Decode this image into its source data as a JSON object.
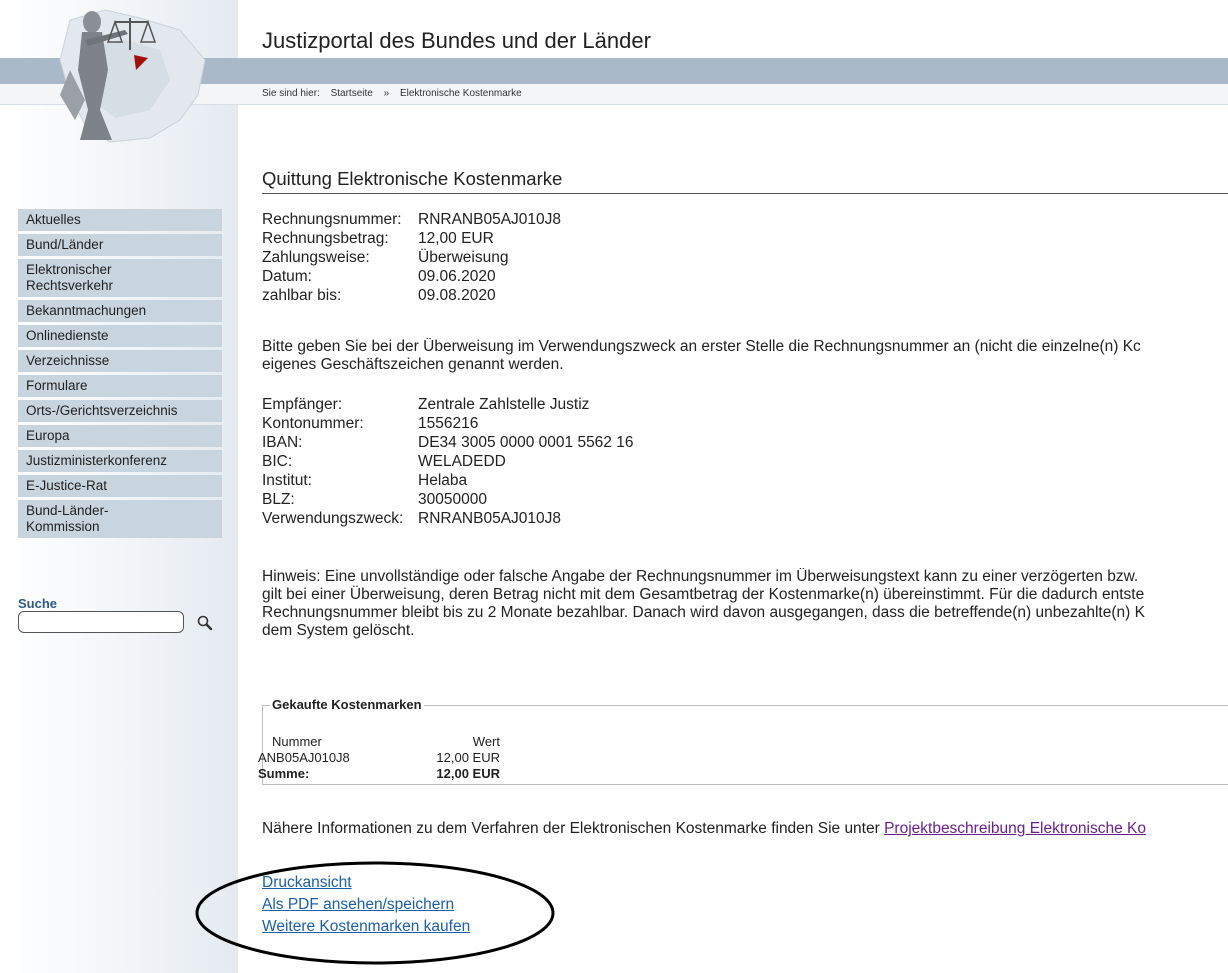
{
  "header": {
    "site_title": "Justizportal des Bundes und der Länder",
    "breadcrumb_prefix": "Sie sind hier:",
    "breadcrumb_home": "Startseite",
    "breadcrumb_sep": "»",
    "breadcrumb_current": "Elektronische Kostenmarke"
  },
  "sidebar": {
    "items": [
      {
        "label": "Aktuelles"
      },
      {
        "label": "Bund/Länder"
      },
      {
        "label": "Elektronischer Rechtsverkehr"
      },
      {
        "label": "Bekanntmachungen"
      },
      {
        "label": "Onlinedienste"
      },
      {
        "label": "Verzeichnisse"
      },
      {
        "label": "Formulare"
      },
      {
        "label": "Orts-/Gerichtsverzeichnis"
      },
      {
        "label": "Europa"
      },
      {
        "label": "Justizministerkonferenz"
      },
      {
        "label": "E-Justice-Rat"
      },
      {
        "label": "Bund-Länder-Kommission"
      }
    ],
    "search_label": "Suche",
    "search_value": ""
  },
  "main": {
    "heading": "Quittung Elektronische Kostenmarke",
    "invoice": {
      "nr_label": "Rechnungsnummer:",
      "nr_value": "RNRANB05AJ010J8",
      "amount_label": "Rechnungsbetrag:",
      "amount_value": "12,00 EUR",
      "method_label": "Zahlungsweise:",
      "method_value": "Überweisung",
      "date_label": "Datum:",
      "date_value": "09.06.2020",
      "due_label": "zahlbar bis:",
      "due_value": "09.08.2020"
    },
    "note1_line1": "Bitte geben Sie bei der Überweisung im Verwendungszweck an erster Stelle die Rechnungsnummer an (nicht die einzelne(n) Kc",
    "note1_line2": "eigenes Geschäftszeichen genannt werden.",
    "bank": {
      "recipient_label": "Empfänger:",
      "recipient_value": "Zentrale Zahlstelle Justiz",
      "account_label": "Kontonummer:",
      "account_value": "1556216",
      "iban_label": "IBAN:",
      "iban_value": "DE34 3005 0000 0001 5562 16",
      "bic_label": "BIC:",
      "bic_value": "WELADEDD",
      "institute_label": "Institut:",
      "institute_value": "Helaba",
      "blz_label": "BLZ:",
      "blz_value": "30050000",
      "purpose_label": "Verwendungszweck:",
      "purpose_value": "RNRANB05AJ010J8"
    },
    "hint": [
      "Hinweis: Eine unvollständige oder falsche Angabe der Rechnungsnummer im Überweisungstext kann zu einer verzögerten bzw.",
      "gilt bei einer Überweisung, deren Betrag nicht mit dem Gesamtbetrag der Kostenmarke(n) übereinstimmt. Für die dadurch entste",
      "Rechnungsnummer bleibt bis zu 2 Monate bezahlbar. Danach wird davon ausgegangen, dass die betreffende(n) unbezahlte(n) K",
      "dem System gelöscht."
    ],
    "purchased": {
      "legend": "Gekaufte Kostenmarken",
      "col_number": "Nummer",
      "col_value": "Wert",
      "row_number": "ANB05AJ010J8",
      "row_value": "12,00 EUR",
      "sum_label": "Summe:",
      "sum_value": "12,00 EUR"
    },
    "info_text": "Nähere Informationen zu dem Verfahren der Elektronischen Kostenmarke finden Sie unter ",
    "info_link": "Projektbeschreibung Elektronische Ko",
    "links": {
      "print": "Druckansicht",
      "pdf": "Als PDF ansehen/speichern",
      "buy_more": "Weitere Kostenmarken kaufen"
    }
  },
  "colors": {
    "band": "#a9b9c7",
    "nav_bg": "#c8d4de",
    "link": "#1b5fa8",
    "visited_link": "#6b1f8f"
  }
}
